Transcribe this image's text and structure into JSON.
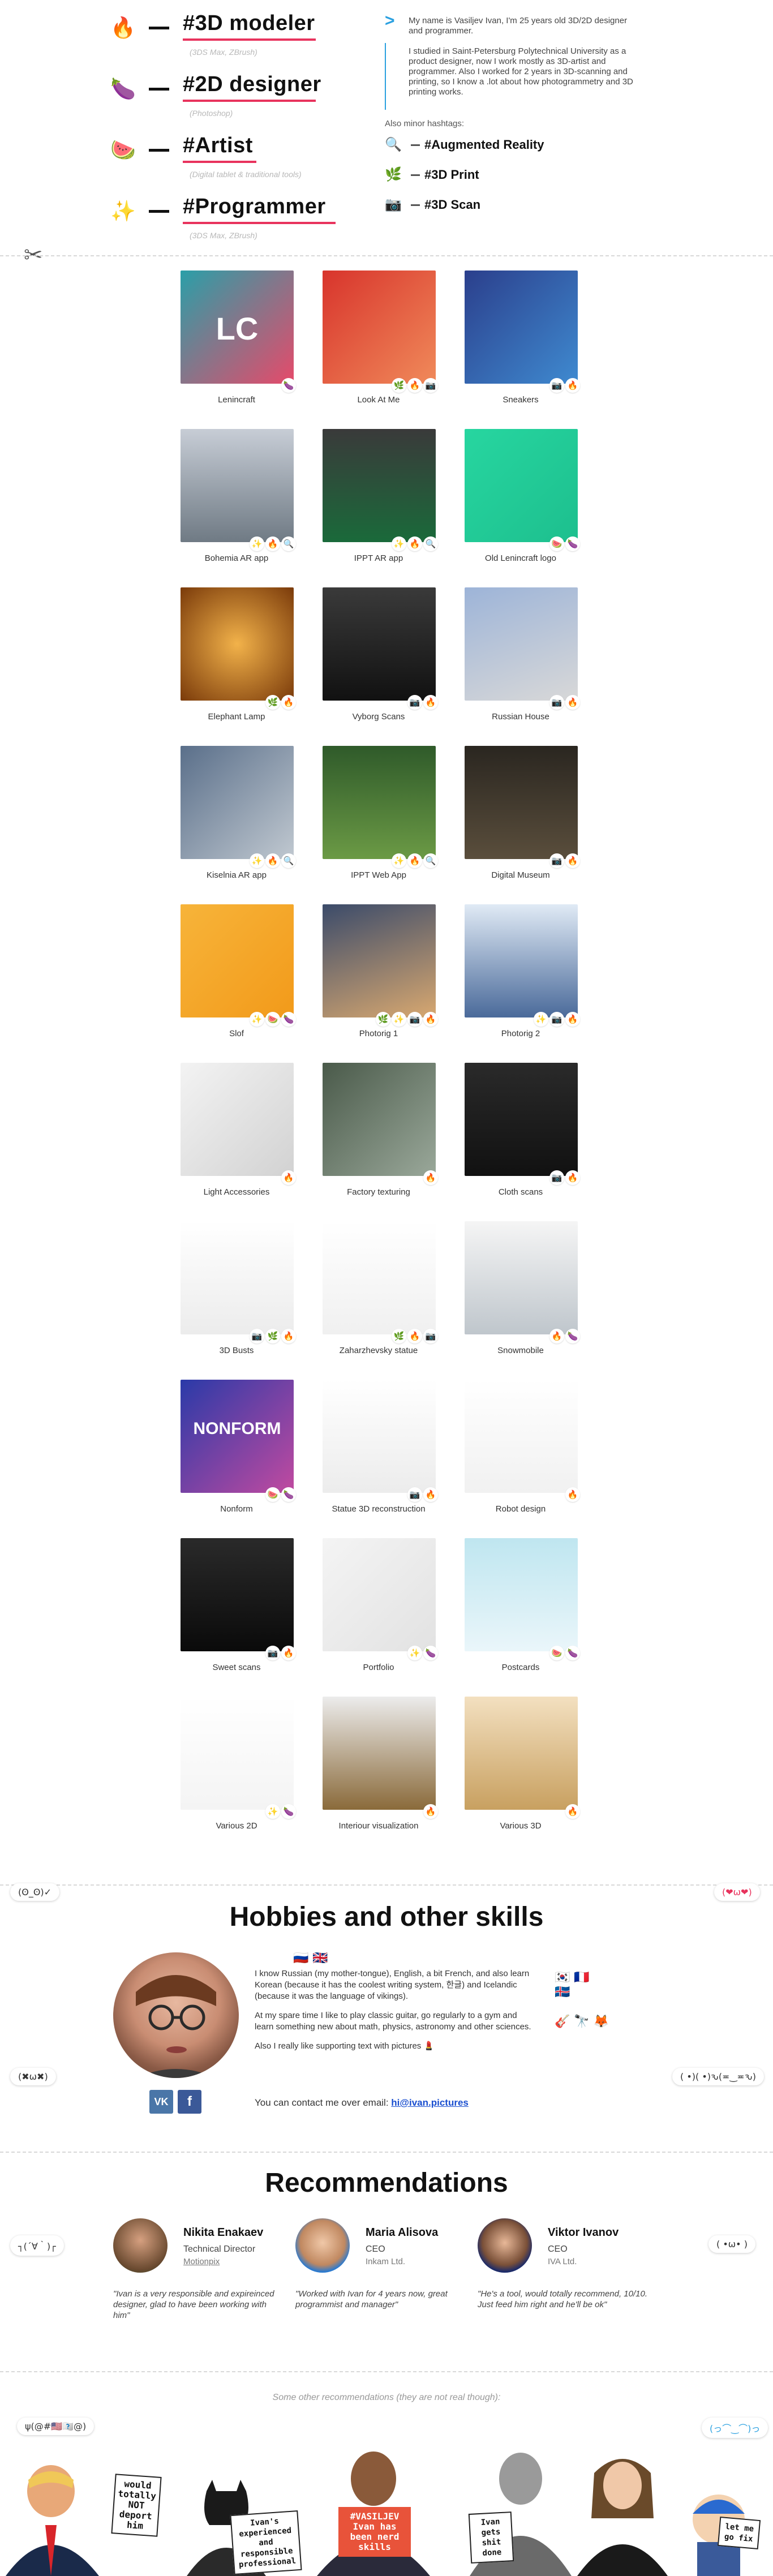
{
  "roles": [
    {
      "emoji": "🔥",
      "title": "#3D modeler",
      "sub": "(3DS Max, ZBrush)"
    },
    {
      "emoji": "🍆",
      "title": "#2D designer",
      "sub": "(Photoshop)"
    },
    {
      "emoji": "🍉",
      "title": "#Artist",
      "sub": "(Digital tablet & traditional tools)"
    },
    {
      "emoji": "✨",
      "title": "#Programmer",
      "sub": "(3DS Max, ZBrush)"
    }
  ],
  "about": {
    "arrow": ">",
    "p1": "My name is Vasiljev Ivan, I'm 25 years old 3D/2D designer and programmer.",
    "p2": "I studied in Saint-Petersburg Polytechnical University as a product designer, now I work mostly as 3D-artist and programmer. Also I worked for 2 years in 3D-scanning and printing, so I know a .lot about how photogrammetry and 3D printing works.",
    "minor_label": "Also minor hashtags:",
    "tags": [
      {
        "icon": "🔍",
        "text": "#Augmented Reality"
      },
      {
        "icon": "🌿",
        "text": "#3D Print"
      },
      {
        "icon": "📷",
        "text": "#3D Scan"
      }
    ]
  },
  "scissors": "✂",
  "portfolio": [
    {
      "caption": "Lenincraft",
      "badges": [
        "🍆"
      ],
      "bg": "linear-gradient(135deg,#2a9fa8,#e64a6a)",
      "label": "LC"
    },
    {
      "caption": "Look At Me",
      "badges": [
        "🌿",
        "🔥",
        "📷"
      ],
      "bg": "linear-gradient(135deg,#d8342c,#f08a5a)",
      "label": ""
    },
    {
      "caption": "Sneakers",
      "badges": [
        "📷",
        "🔥"
      ],
      "bg": "linear-gradient(135deg,#2b3f8c,#3f8ad0)",
      "label": ""
    },
    {
      "caption": "Bohemia AR app",
      "badges": [
        "✨",
        "🔥",
        "🔍"
      ],
      "bg": "linear-gradient(180deg,#c7cdd6,#6f7a84)",
      "label": ""
    },
    {
      "caption": "IPPT AR app",
      "badges": [
        "✨",
        "🔥",
        "🔍"
      ],
      "bg": "linear-gradient(180deg,#3a3a3a,#1a6a3a)",
      "label": ""
    },
    {
      "caption": "Old Lenincraft logo",
      "badges": [
        "🍉",
        "🍆"
      ],
      "bg": "linear-gradient(135deg,#27d6a0,#1dbf8e)",
      "label": ""
    },
    {
      "caption": "Elephant Lamp",
      "badges": [
        "🌿",
        "🔥"
      ],
      "bg": "radial-gradient(circle,#f2b24a,#7a3a0a)",
      "label": ""
    },
    {
      "caption": "Vyborg Scans",
      "badges": [
        "📷",
        "🔥"
      ],
      "bg": "linear-gradient(180deg,#3a3a3a,#111)",
      "label": ""
    },
    {
      "caption": "Russian House",
      "badges": [
        "📷",
        "🔥"
      ],
      "bg": "linear-gradient(160deg,#9db4d8,#d8d8d8)",
      "label": ""
    },
    {
      "caption": "Kiselnia AR app",
      "badges": [
        "✨",
        "🔥",
        "🔍"
      ],
      "bg": "linear-gradient(135deg,#5a6f8a,#c0c8d0)",
      "label": ""
    },
    {
      "caption": "IPPT Web App",
      "badges": [
        "✨",
        "🔥",
        "🔍"
      ],
      "bg": "linear-gradient(180deg,#2f5a2a,#6b9a45)",
      "label": ""
    },
    {
      "caption": "Digital Museum",
      "badges": [
        "📷",
        "🔥"
      ],
      "bg": "linear-gradient(180deg,#2a2620,#5a4e3c)",
      "label": ""
    },
    {
      "caption": "Slof",
      "badges": [
        "✨",
        "🍉",
        "🍆"
      ],
      "bg": "linear-gradient(135deg,#f7b43a,#f29a1a)",
      "label": ""
    },
    {
      "caption": "Photorig 1",
      "badges": [
        "🌿",
        "✨",
        "📷",
        "🔥"
      ],
      "bg": "linear-gradient(160deg,#3b4b6a,#d8a870)",
      "label": ""
    },
    {
      "caption": "Photorig 2",
      "badges": [
        "✨",
        "📷",
        "🔥"
      ],
      "bg": "linear-gradient(180deg,#e0eaf5,#4a6a9a)",
      "label": ""
    },
    {
      "caption": "Light Accessories",
      "badges": [
        "🔥"
      ],
      "bg": "linear-gradient(135deg,#f3f3f3,#d2d2d2)",
      "label": ""
    },
    {
      "caption": "Factory texturing",
      "badges": [
        "🔥"
      ],
      "bg": "linear-gradient(135deg,#4a5a4a,#9aa89a)",
      "label": ""
    },
    {
      "caption": "Cloth scans",
      "badges": [
        "📷",
        "🔥"
      ],
      "bg": "linear-gradient(180deg,#2a2a2a,#111)",
      "label": ""
    },
    {
      "caption": "3D Busts",
      "badges": [
        "📷",
        "🌿",
        "🔥"
      ],
      "bg": "linear-gradient(180deg,#ffffff,#ececec)",
      "label": ""
    },
    {
      "caption": "Zaharzhevsky statue",
      "badges": [
        "🌿",
        "🔥",
        "📷"
      ],
      "bg": "linear-gradient(180deg,#ffffff,#f0f0f0)",
      "label": ""
    },
    {
      "caption": "Snowmobile",
      "badges": [
        "🔥",
        "🍆"
      ],
      "bg": "linear-gradient(180deg,#f5f5f5,#bfc6cc)",
      "label": ""
    },
    {
      "caption": "Nonform",
      "badges": [
        "🍉",
        "🍆"
      ],
      "bg": "linear-gradient(135deg,#2a3aa8,#c14aa0)",
      "label": "NONFORM"
    },
    {
      "caption": "Statue 3D reconstruction",
      "badges": [
        "📷",
        "🔥"
      ],
      "bg": "linear-gradient(180deg,#ffffff,#ececec)",
      "label": ""
    },
    {
      "caption": "Robot design",
      "badges": [
        "🔥"
      ],
      "bg": "linear-gradient(180deg,#ffffff,#f1f1f1)",
      "label": ""
    },
    {
      "caption": "Sweet scans",
      "badges": [
        "📷",
        "🔥"
      ],
      "bg": "linear-gradient(180deg,#2a2a2a,#0a0a0a)",
      "label": ""
    },
    {
      "caption": "Portfolio",
      "badges": [
        "✨",
        "🍆"
      ],
      "bg": "linear-gradient(135deg,#f4f4f4,#e2e2e2)",
      "label": ""
    },
    {
      "caption": "Postcards",
      "badges": [
        "🍉",
        "🍆"
      ],
      "bg": "linear-gradient(180deg,#bfe6f0,#eaf6fa)",
      "label": ""
    },
    {
      "caption": "Various 2D",
      "badges": [
        "✨",
        "🍆"
      ],
      "bg": "linear-gradient(180deg,#ffffff,#f4f4f4)",
      "label": ""
    },
    {
      "caption": "Interiour visualization",
      "badges": [
        "🔥"
      ],
      "bg": "linear-gradient(180deg,#ececec,#8a6a3a)",
      "label": ""
    },
    {
      "caption": "Various 3D",
      "badges": [
        "🔥"
      ],
      "bg": "linear-gradient(180deg,#f3e0c0,#c8a060)",
      "label": ""
    }
  ],
  "hobbies": {
    "title": "Hobbies and other skills",
    "p1": "I know Russian (my mother-tongue), English, a bit French, and also learn Korean (because it has the coolest writing system, 한글) and Icelandic (because it was the language of vikings).",
    "p2": "At my spare time I like to play classic guitar, go regularly to a gym and learn something new about math, physics, astronomy and other sciences.",
    "p3": "Also I really like supporting text with pictures 💄",
    "contact_prefix": "You can contact me over email:",
    "email": "hi@ivan.pictures",
    "flags_top": "🇷🇺           🇬🇧",
    "flags_right": "🇰🇷 🇫🇷\n🇮🇸",
    "icons_right": "🎸 🔭 🦊",
    "vk": "VK",
    "fb": "f"
  },
  "kaomoji": {
    "k1": "(ʘ_ʘ)✓",
    "k2": "(❤ω❤)",
    "k3": "(✖ω✖)",
    "k4": "( •)( •)ԅ(≖‿≖ԅ)",
    "k5": "┐(´∀｀)┌",
    "k6": "( •ω• )",
    "k7": "ψ(@#🇺🇸🇸🇺@)",
    "k8": "(っ⌒‿⌒)っ"
  },
  "recommendations": {
    "title": "Recommendations",
    "items": [
      {
        "name": "Nikita Enakaev",
        "role": "Technical Director",
        "company": "Motionpix",
        "quote": "\"Ivan is a very responsible and expireinced designer, glad to have been working with him\""
      },
      {
        "name": "Maria Alisova",
        "role": "CEO",
        "company": "Inkam Ltd.",
        "quote": "\"Worked with Ivan for 4 years now, great programmist and manager\""
      },
      {
        "name": "Viktor Ivanov",
        "role": "CEO",
        "company": "IVA Ltd.",
        "quote": "\"He's a tool, would totally recommend, 10/10. Just feed him right and he'll be ok\""
      }
    ],
    "other_note": "Some other recommendations (they are not real though):",
    "signs": [
      "would totally NOT deport him",
      "Ivan's experienced and responsible professional",
      "#VASILJEV Ivan has been nerd skills",
      "Ivan gets shit done",
      "let me go fix"
    ]
  },
  "colors": {
    "accent_pink": "#e8335d",
    "accent_blue": "#2aa0e0",
    "vk": "#4a76a8",
    "fb": "#3b5998",
    "link": "#1a4fd0"
  }
}
